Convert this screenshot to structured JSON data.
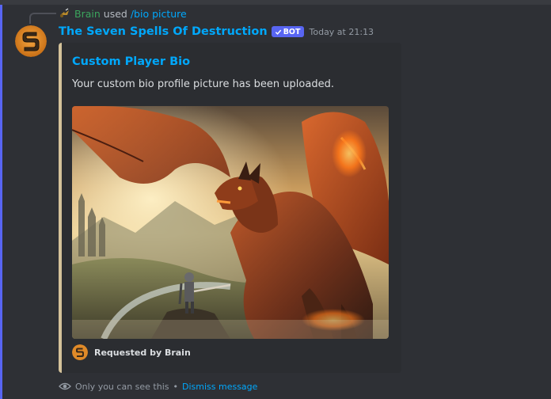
{
  "reply": {
    "user": "Brain",
    "used_text": "used",
    "command": "/bio picture",
    "command_icon": "slash-command-icon"
  },
  "author": {
    "name": "The Seven Spells Of Destruction",
    "badge": "BOT",
    "timestamp": "Today at 21:13",
    "avatar_icon": "letter-s-logo-icon"
  },
  "embed": {
    "accent_color": "#d4c29a",
    "title": "Custom Player Bio",
    "description": "Your custom bio profile picture has been uploaded.",
    "image_icon": "dragon-knight-artwork",
    "footer": "Requested by Brain"
  },
  "ephemeral": {
    "text": "Only you can see this",
    "separator": "•",
    "dismiss": "Dismiss message",
    "icon": "eye-icon"
  },
  "colors": {
    "link": "#00a8fc",
    "bot_badge": "#5865f2",
    "highlight": "#5865f2",
    "reply_user": "#3ba55d"
  }
}
